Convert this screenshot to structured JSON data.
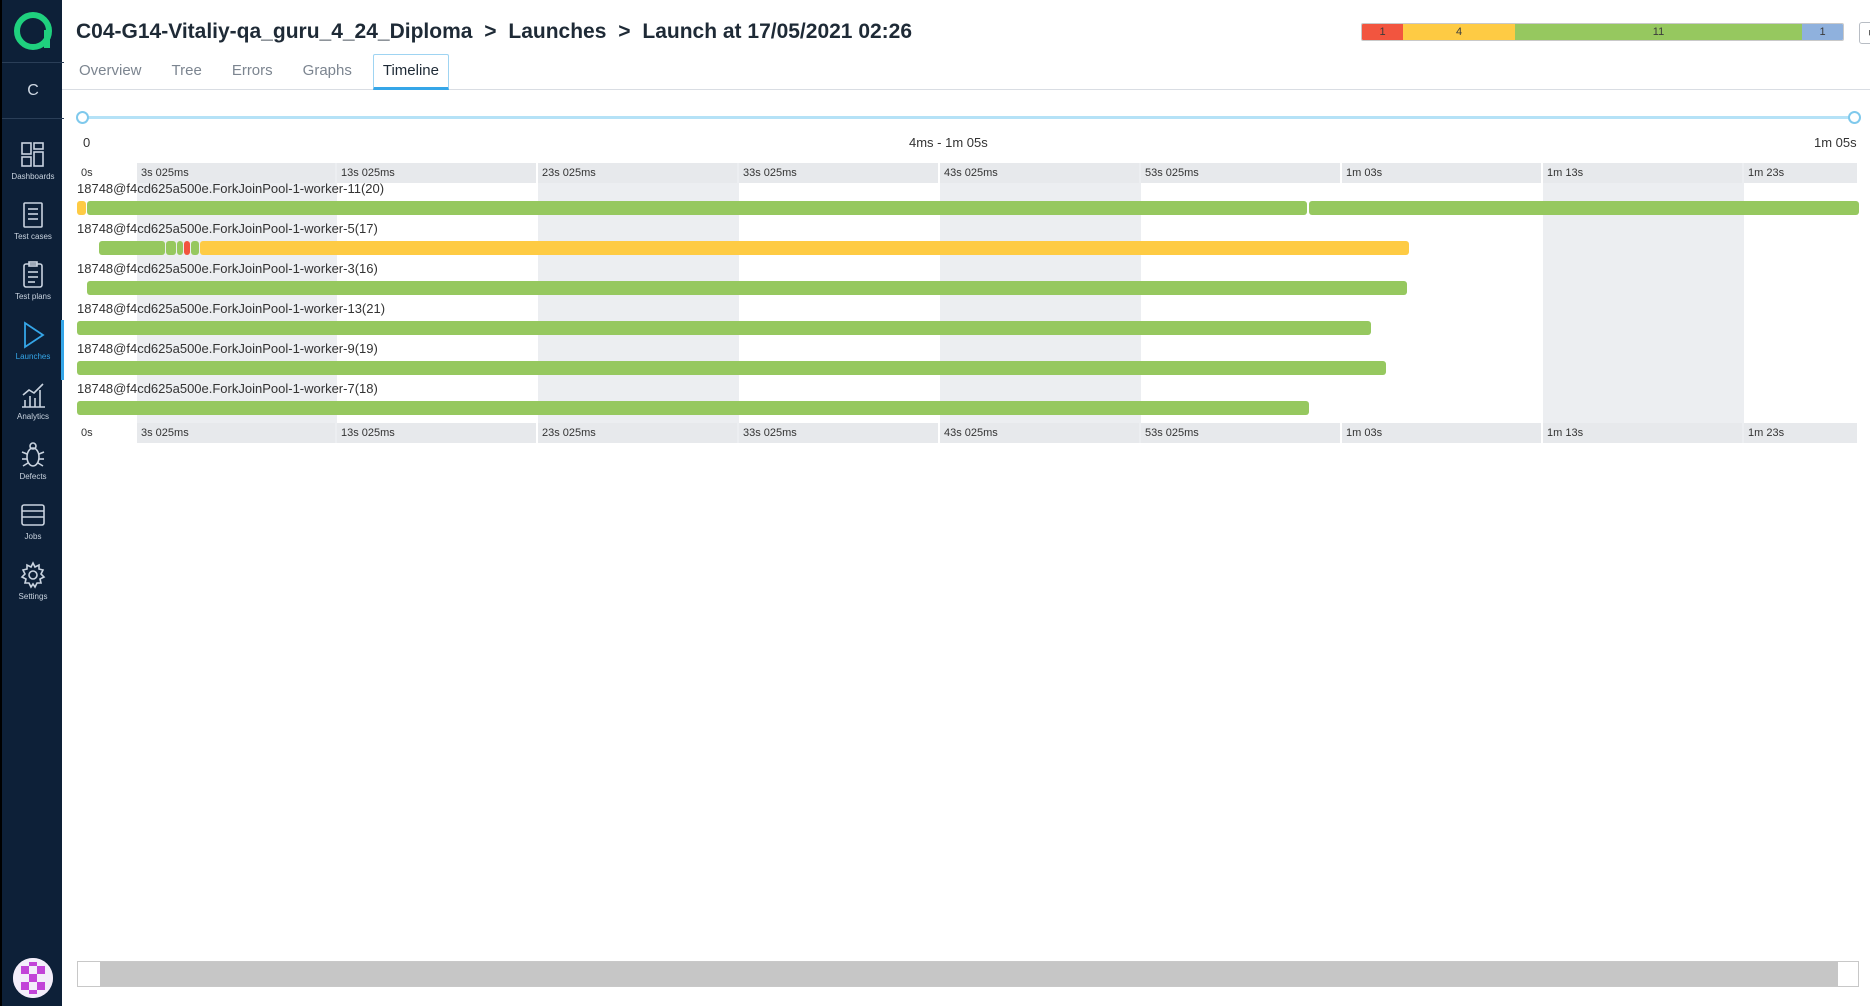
{
  "breadcrumb": {
    "project": "C04-G14-Vitaliy-qa_guru_4_24_Diploma",
    "section": "Launches",
    "launch": "Launch at 17/05/2021 02:26",
    "separator": ">"
  },
  "tabs": [
    {
      "label": "Overview"
    },
    {
      "label": "Tree"
    },
    {
      "label": "Errors"
    },
    {
      "label": "Graphs"
    },
    {
      "label": "Timeline",
      "active": true
    }
  ],
  "status_summary": [
    {
      "count": "1",
      "status": "failed",
      "color": "#f2553f"
    },
    {
      "count": "4",
      "status": "skipped",
      "color": "#fecb44"
    },
    {
      "count": "11",
      "status": "passed",
      "color": "#96c85f"
    },
    {
      "count": "1",
      "status": "unknown",
      "color": "#8fb1dd"
    }
  ],
  "header_buttons": {
    "stop_icon": "■",
    "menu_icon": "≡"
  },
  "sidebar": {
    "project_initial": "C",
    "items": [
      {
        "label": "Dashboards",
        "icon": "dashboards-icon"
      },
      {
        "label": "Test cases",
        "icon": "test-cases-icon"
      },
      {
        "label": "Test plans",
        "icon": "test-plans-icon"
      },
      {
        "label": "Launches",
        "icon": "launches-icon",
        "active": true
      },
      {
        "label": "Analytics",
        "icon": "analytics-icon"
      },
      {
        "label": "Defects",
        "icon": "defects-icon"
      },
      {
        "label": "Jobs",
        "icon": "jobs-icon"
      },
      {
        "label": "Settings",
        "icon": "settings-icon"
      }
    ]
  },
  "range": {
    "min_label": "0",
    "selection_label": "4ms - 1m 05s",
    "max_label": "1m 05s"
  },
  "timeline": {
    "ticks": [
      "0s",
      "3s 025ms",
      "13s 025ms",
      "23s 025ms",
      "33s 025ms",
      "43s 025ms",
      "53s 025ms",
      "1m 03s",
      "1m 13s",
      "1m 23s"
    ],
    "workers": [
      {
        "name": "18748@f4cd625a500e.ForkJoinPool-1-worker-11(20)"
      },
      {
        "name": "18748@f4cd625a500e.ForkJoinPool-1-worker-5(17)"
      },
      {
        "name": "18748@f4cd625a500e.ForkJoinPool-1-worker-3(16)"
      },
      {
        "name": "18748@f4cd625a500e.ForkJoinPool-1-worker-13(21)"
      },
      {
        "name": "18748@f4cd625a500e.ForkJoinPool-1-worker-9(19)"
      },
      {
        "name": "18748@f4cd625a500e.ForkJoinPool-1-worker-7(18)"
      }
    ]
  },
  "colors": {
    "passed": "#96c85f",
    "skipped": "#fecb44",
    "failed": "#f2553f",
    "accent": "#35a6e8",
    "sidebar_bg": "#0d2038"
  }
}
